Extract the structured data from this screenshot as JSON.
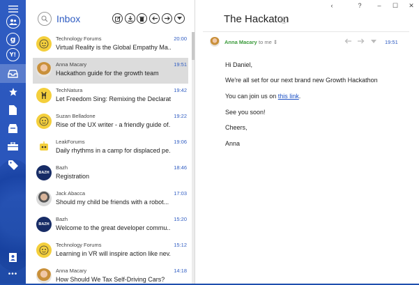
{
  "rail": {
    "items": [
      {
        "name": "menu-icon"
      },
      {
        "name": "people-icon"
      },
      {
        "name": "google-account-icon",
        "label": "g"
      },
      {
        "name": "yahoo-account-icon",
        "label": "Y!"
      },
      {
        "name": "inbox-icon"
      },
      {
        "name": "star-icon"
      },
      {
        "name": "document-icon"
      },
      {
        "name": "archive-icon"
      },
      {
        "name": "briefcase-icon"
      },
      {
        "name": "tag-icon"
      },
      {
        "name": "contact-card-icon"
      },
      {
        "name": "more-icon",
        "label": "•••"
      }
    ]
  },
  "list": {
    "folder_title": "Inbox",
    "messages": [
      {
        "sender": "Technology Forums",
        "subject": "Virtual Reality is the Global Empathy Ma...",
        "time": "20:00",
        "avatar": "yellow-face"
      },
      {
        "sender": "Anna Macary",
        "subject": "Hackathon guide for the growth team",
        "time": "19:51",
        "avatar": "photo-female"
      },
      {
        "sender": "TechNatura",
        "subject": "Let Freedom Sing: Remixing the Declarati...",
        "time": "19:42",
        "avatar": "yellow-deer"
      },
      {
        "sender": "Suzan Belladone",
        "subject": "Rise of the UX writer - a friendly guide of...",
        "time": "19:22",
        "avatar": "yellow-face"
      },
      {
        "sender": "LeakForums",
        "subject": "Daily rhythms in a camp for displaced pe...",
        "time": "19:06",
        "avatar": "yellow-robot"
      },
      {
        "sender": "Bazh",
        "subject": "Registration",
        "time": "18:46",
        "avatar": "navy-logo",
        "logo_text": "BAZH"
      },
      {
        "sender": "Jack Abacca",
        "subject": "Should my child be friends with a robot...",
        "time": "17:03",
        "avatar": "photo-male"
      },
      {
        "sender": "Bazh",
        "subject": "Welcome to the great developer commu...",
        "time": "15:20",
        "avatar": "navy-logo",
        "logo_text": "BAZH"
      },
      {
        "sender": "Technology Forums",
        "subject": "Learning in VR will inspire action like nev...",
        "time": "15:12",
        "avatar": "yellow-face"
      },
      {
        "sender": "Anna Macary",
        "subject": "How Should We Tax Self-Driving Cars?",
        "time": "14:18",
        "avatar": "photo-female"
      }
    ]
  },
  "window": {
    "controls": [
      "‹",
      "?",
      "–",
      "☐",
      "✕"
    ]
  },
  "email": {
    "title": "The Hackaton",
    "from_name": "Anna Macary",
    "to_text": "to me",
    "time": "19:51",
    "body": {
      "greeting": "Hi Daniel,",
      "line1": "We're all set for our next brand new Growth Hackathon",
      "line2_prefix": "You can join us on ",
      "line2_link": "this link",
      "line2_suffix": ".",
      "line3": "See you soon!",
      "closing": "Cheers,",
      "signature": "Anna"
    }
  },
  "colors": {
    "accent": "#2f5cc2",
    "rail": "#2a56bc",
    "sender_green": "#3a9a3a",
    "selected_row": "#dcdcdc"
  }
}
